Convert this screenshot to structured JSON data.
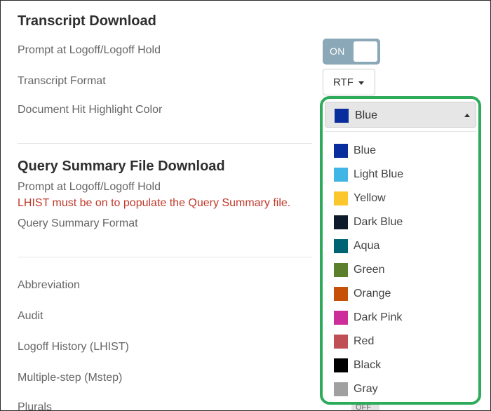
{
  "transcript_download": {
    "title": "Transcript Download",
    "prompt_label": "Prompt at Logoff/Logoff Hold",
    "prompt_toggle": "ON",
    "format_label": "Transcript Format",
    "format_value": "RTF",
    "highlight_label": "Document Hit Highlight Color"
  },
  "query_summary": {
    "title": "Query Summary File Download",
    "prompt_label": "Prompt at Logoff/Logoff Hold",
    "warning": "LHIST must be on to populate the Query Summary file.",
    "format_label": "Query Summary Format"
  },
  "options": {
    "abbreviation": "Abbreviation",
    "audit": "Audit",
    "logoff_history": "Logoff History (LHIST)",
    "multiple_step": "Multiple-step (Mstep)",
    "plurals": "Plurals",
    "plurals_toggle": "OFF"
  },
  "color_dropdown": {
    "selected": "Blue",
    "selected_color": "#0a2d9e",
    "items": [
      {
        "name": "Blue",
        "color": "#0a2d9e"
      },
      {
        "name": "Light Blue",
        "color": "#41b6e6"
      },
      {
        "name": "Yellow",
        "color": "#fcc62d"
      },
      {
        "name": "Dark Blue",
        "color": "#0c1a2b"
      },
      {
        "name": "Aqua",
        "color": "#006373"
      },
      {
        "name": "Green",
        "color": "#5b7f2b"
      },
      {
        "name": "Orange",
        "color": "#c65007"
      },
      {
        "name": "Dark Pink",
        "color": "#cc2d9a"
      },
      {
        "name": "Red",
        "color": "#bf4e55"
      },
      {
        "name": "Black",
        "color": "#000000"
      },
      {
        "name": "Gray",
        "color": "#a0a0a0"
      }
    ]
  }
}
